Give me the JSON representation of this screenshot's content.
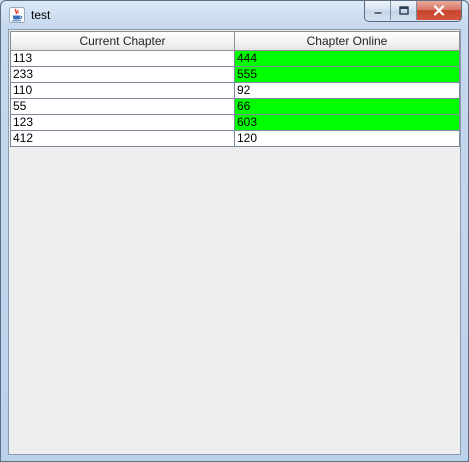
{
  "window": {
    "title": "test",
    "icon": "java-cup-icon",
    "buttons": [
      "minimize-icon",
      "maximize-icon",
      "close-icon"
    ]
  },
  "table": {
    "columns": [
      "Current Chapter",
      "Chapter Online"
    ],
    "highlight_color": "#00ff00",
    "rows": [
      {
        "current": "113",
        "online": "444",
        "highlight": true
      },
      {
        "current": "233",
        "online": "555",
        "highlight": true
      },
      {
        "current": "110",
        "online": "92",
        "highlight": false
      },
      {
        "current": "55",
        "online": "66",
        "highlight": true
      },
      {
        "current": "123",
        "online": "603",
        "highlight": true
      },
      {
        "current": "412",
        "online": "120",
        "highlight": false
      }
    ]
  }
}
